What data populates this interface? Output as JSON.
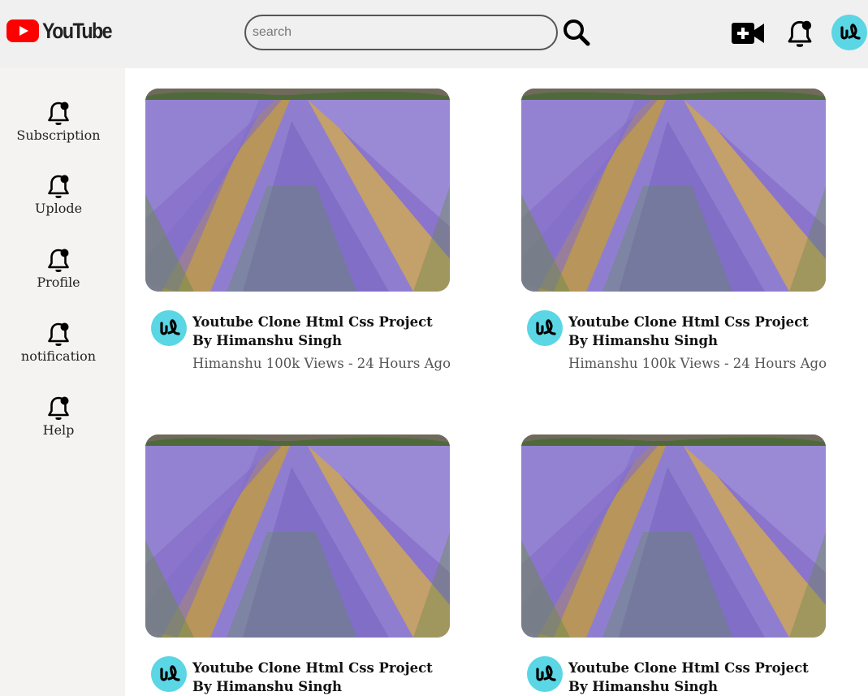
{
  "header": {
    "logo_text": "YouTube",
    "search_placeholder": "search",
    "search_value": "",
    "icons": [
      "create-video-icon",
      "notification-bell-icon",
      "user-avatar"
    ]
  },
  "sidebar": {
    "items": [
      {
        "label": "Subscription",
        "icon": "bell-icon"
      },
      {
        "label": "Uplode",
        "icon": "bell-icon"
      },
      {
        "label": "Profile",
        "icon": "bell-icon"
      },
      {
        "label": "notification",
        "icon": "bell-icon"
      },
      {
        "label": "Help",
        "icon": "bell-icon"
      }
    ]
  },
  "videos": [
    {
      "title": "Youtube Clone Html Css Project By Himanshu Singh",
      "meta": "Himanshu 100k Views - 24 Hours Ago"
    },
    {
      "title": "Youtube Clone Html Css Project By Himanshu Singh",
      "meta": "Himanshu 100k Views - 24 Hours Ago"
    },
    {
      "title": "Youtube Clone Html Css Project By Himanshu Singh",
      "meta": ""
    },
    {
      "title": "Youtube Clone Html Css Project By Himanshu Singh",
      "meta": ""
    }
  ],
  "colors": {
    "header_bg": "#f0f0f0",
    "sidebar_bg": "#f5f3f2",
    "brand_red": "#ff0000",
    "avatar_cyan": "#5ad6e5"
  }
}
